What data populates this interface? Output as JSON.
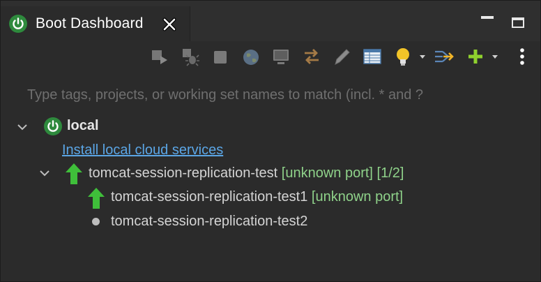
{
  "tab": {
    "title": "Boot Dashboard",
    "icon": "spring-power-icon"
  },
  "window_controls": {
    "minimize_icon": "minimize-icon",
    "maximize_icon": "maximize-icon"
  },
  "toolbar": {
    "icons": [
      "restart-icon",
      "debug-icon",
      "stop-icon",
      "open-browser-icon",
      "open-console-icon",
      "sync-icon",
      "edit-icon",
      "table-icon",
      "lightbulb-icon",
      "link-icon",
      "add-icon",
      "more-icon"
    ]
  },
  "filter": {
    "placeholder": "Type tags, projects, or working set names to match (incl. * and ?"
  },
  "tree": {
    "local": {
      "label": "local"
    },
    "install_link": "Install local cloud services",
    "app": {
      "name": "tomcat-session-replication-test",
      "port": "[unknown port]",
      "instances": "[1/2]"
    },
    "instances": [
      {
        "name": "tomcat-session-replication-test1",
        "port": "[unknown port]",
        "status": "running"
      },
      {
        "name": "tomcat-session-replication-test2",
        "status": "stopped"
      }
    ]
  },
  "colors": {
    "background": "#2b2b2b",
    "accent_green": "#2e8a3d",
    "link": "#5ba6e6",
    "status_text": "#8fd28a"
  }
}
